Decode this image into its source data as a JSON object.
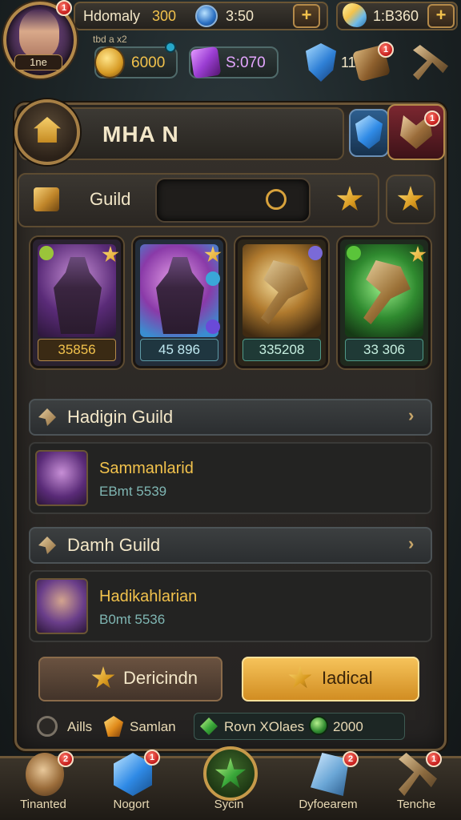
{
  "hud": {
    "player_name": "Hdomaly",
    "gold_top": "300",
    "timer": "3:50",
    "plus": "+",
    "energy": "1:B360",
    "sub_label": "tbd a x2",
    "avatar_level": "1ne",
    "avatar_badge": "1",
    "gold": "6000",
    "purple": "S:070",
    "shield_count": "11",
    "chest_badge": "1"
  },
  "guild": {
    "title": "MHA N",
    "red_emblem_badge": "1",
    "tab_label": "Guild",
    "search_placeholder": ""
  },
  "cards": [
    {
      "value": "35856"
    },
    {
      "value": "45 896"
    },
    {
      "value": "335208"
    },
    {
      "value": "33 306"
    }
  ],
  "sections": [
    {
      "title": "Hadigin Guild",
      "member_name": "Sammanlarid",
      "member_sub": "EBmt 5539"
    },
    {
      "title": "Damh Guild",
      "member_name": "Hadikahlarian",
      "member_sub": "B0mt 5536"
    }
  ],
  "buttons": {
    "left": "Dericindn",
    "right": "Iadical"
  },
  "status": {
    "left_label": "Aills",
    "middle_label": "Samlan",
    "pill_label": "Rovn XOlaes",
    "pill_value": "2000"
  },
  "nav": [
    {
      "label": "Tinanted",
      "badge": "2"
    },
    {
      "label": "Nogort",
      "badge": "1"
    },
    {
      "label": "Sycin",
      "badge": ""
    },
    {
      "label": "Dyfoearem",
      "badge": "2"
    },
    {
      "label": "Tenche",
      "badge": "1"
    }
  ],
  "colors": {
    "accent_gold": "#f2c24c",
    "panel_border": "#6c5637",
    "badge_red": "#c31b1b"
  }
}
